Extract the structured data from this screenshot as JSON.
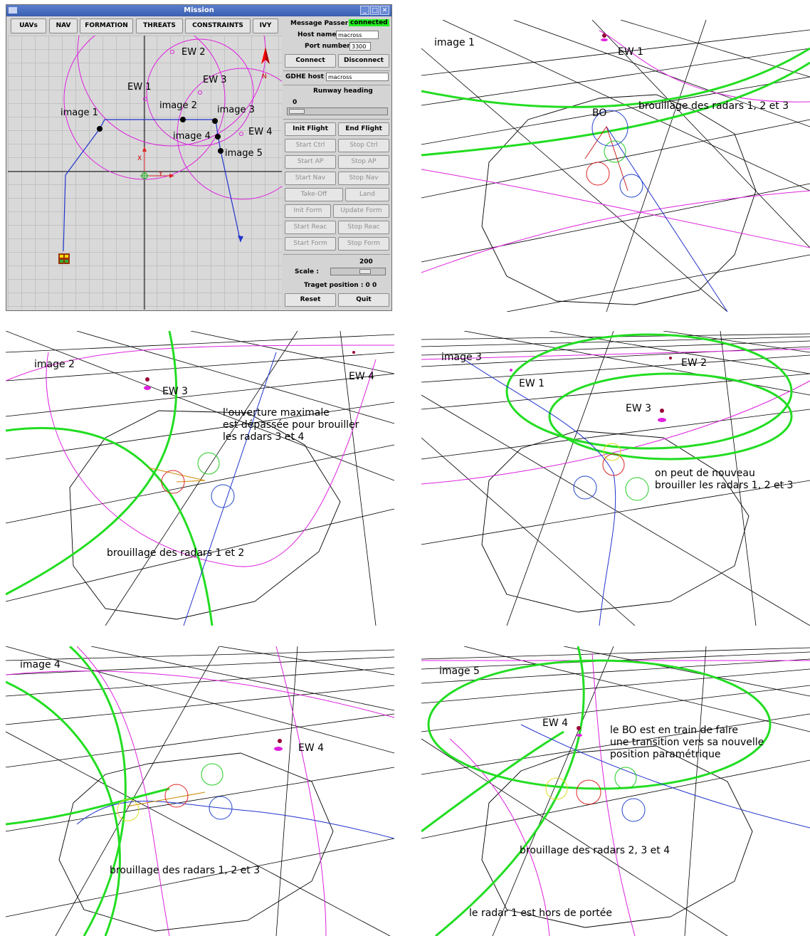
{
  "window": {
    "title": "Mission",
    "menu": [
      "UAVs",
      "NAV",
      "FORMATION",
      "THREATS",
      "CONSTRAINTS",
      "IVY"
    ],
    "controls": {
      "message_passer_label": "Message Passer",
      "message_passer_status": "connected",
      "host_name_label": "Host name",
      "host_name_value": "macross",
      "port_number_label": "Port number",
      "port_number_value": "3300",
      "connect": "Connect",
      "disconnect": "Disconnect",
      "gdhe_host_label": "GDHE host",
      "gdhe_host_value": "macross",
      "runway_heading_label": "Runway heading",
      "runway_heading_value": "0",
      "init_flight": "Init Flight",
      "end_flight": "End Flight",
      "start_ctrl": "Start Ctrl",
      "stop_ctrl": "Stop Ctrl",
      "start_ap": "Start AP",
      "stop_ap": "Stop AP",
      "start_nav": "Start Nav",
      "stop_nav": "Stop Nav",
      "take_off": "Take-Off",
      "land": "Land",
      "init_form": "Init Form",
      "update_form": "Update Form",
      "start_reac": "Start Reac",
      "stop_reac": "Stop Reac",
      "start_form": "Start Form",
      "stop_form": "Stop Form",
      "scale_label": "Scale :",
      "scale_value": "200",
      "target_position": "Traget position : 0  0",
      "reset": "Reset",
      "quit": "Quit"
    },
    "map": {
      "labels": {
        "ew1": "EW 1",
        "ew2": "EW 2",
        "ew3": "EW 3",
        "ew4": "EW 4",
        "image1": "image 1",
        "image2": "image 2",
        "image3": "image 3",
        "image4": "image 4",
        "image5": "image 5",
        "north": "N",
        "axis_x": "X",
        "axis_y": "Y"
      }
    }
  },
  "colors": {
    "jam_circle": "#22dd22",
    "threat": "#dd22dd",
    "track": "#2233cc",
    "status_ok": "#22ee22",
    "title_bar": "#4a6fc1"
  },
  "views": {
    "v1": {
      "title": "image 1",
      "ew1": "EW 1",
      "bo": "BO",
      "caption": "brouillage des radars 1, 2 et 3"
    },
    "v2": {
      "title": "image 2",
      "ew3": "EW 3",
      "ew4": "EW 4",
      "note_line1": "l'ouverture maximale",
      "note_line2": "est dépassée pour brouiller",
      "note_line3": "les radars 3 et 4",
      "caption": "brouillage des radars 1 et 2"
    },
    "v3": {
      "title": "image 3",
      "ew1": "EW 1",
      "ew2": "EW 2",
      "ew3": "EW 3",
      "note_line1": "on peut de nouveau",
      "note_line2": "brouiller les radars 1, 2 et 3"
    },
    "v4": {
      "title": "image 4",
      "ew4": "EW 4",
      "caption": "brouillage des radars 1, 2 et 3"
    },
    "v5": {
      "title": "image 5",
      "ew4": "EW 4",
      "note_line1": "le BO est en train de faire",
      "note_line2": "une transition vers sa nouvelle",
      "note_line3": "position paramétrique",
      "caption": "brouillage des radars 2, 3 et 4",
      "caption2": "le radar 1 est hors de portée"
    }
  }
}
